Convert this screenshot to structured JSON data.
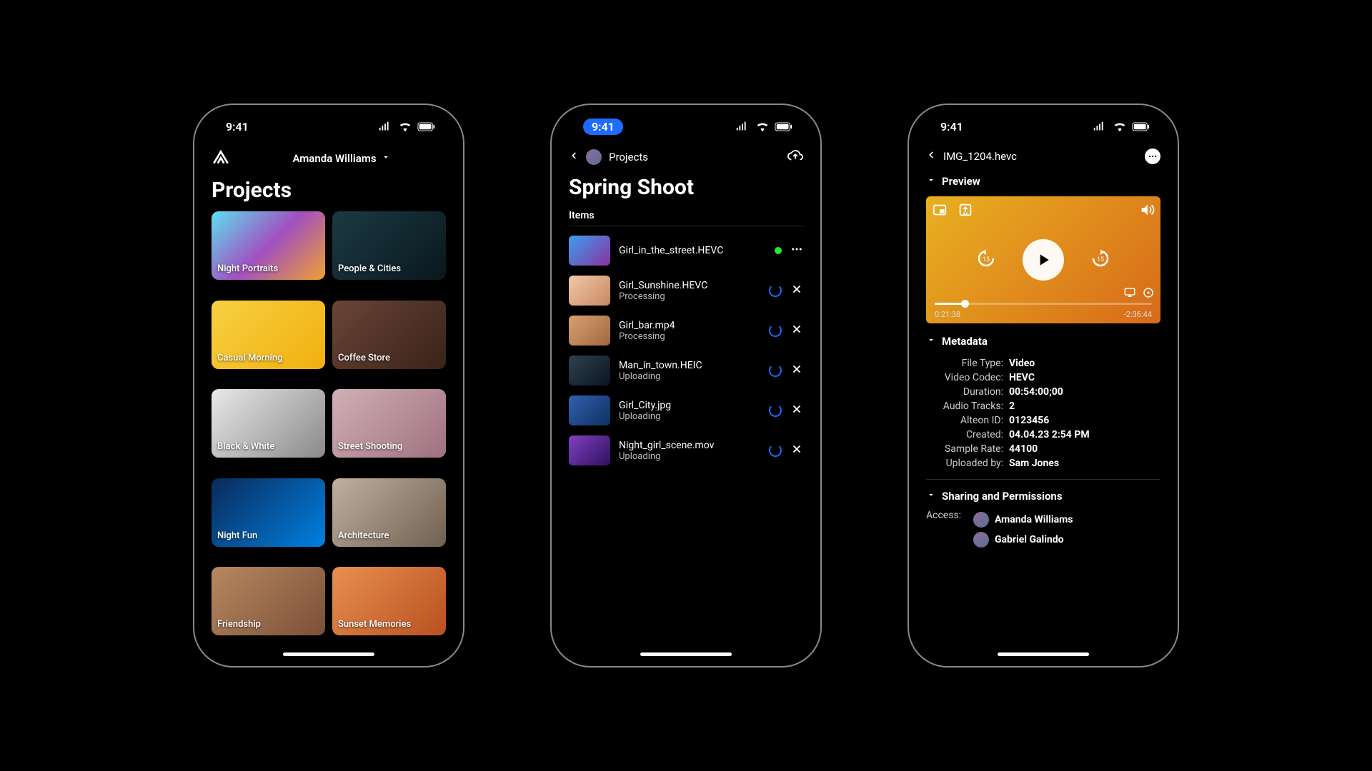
{
  "status_time": "9:41",
  "phone1": {
    "user": "Amanda Williams",
    "title": "Projects",
    "cards": [
      "Night Portraits",
      "People & Cities",
      "Casual Morning",
      "Coffee Store",
      "Black & White",
      "Street Shooting",
      "Night Fun",
      "Architecture",
      "Friendship",
      "Sunset Memories"
    ]
  },
  "phone2": {
    "breadcrumb": "Projects",
    "title": "Spring Shoot",
    "section": "Items",
    "items": [
      {
        "name": "Girl_in_the_street.HEVC",
        "status": "",
        "state": "done"
      },
      {
        "name": "Girl_Sunshine.HEVC",
        "status": "Processing",
        "state": "proc"
      },
      {
        "name": "Girl_bar.mp4",
        "status": "Processing",
        "state": "proc"
      },
      {
        "name": "Man_in_town.HEIC",
        "status": "Uploading",
        "state": "up"
      },
      {
        "name": "Girl_City.jpg",
        "status": "Uploading",
        "state": "up"
      },
      {
        "name": "Night_girl_scene.mov",
        "status": "Uploading",
        "state": "up"
      }
    ]
  },
  "phone3": {
    "filename": "IMG_1204.hevc",
    "section_preview": "Preview",
    "time_elapsed": "0:21:38",
    "time_remain": "-2:36:44",
    "section_meta": "Metadata",
    "meta": [
      {
        "k": "File Type:",
        "v": "Video"
      },
      {
        "k": "Video Codec:",
        "v": "HEVC"
      },
      {
        "k": "Duration:",
        "v": "00:54:00;00"
      },
      {
        "k": "Audio Tracks:",
        "v": "2"
      },
      {
        "k": "Alteon ID:",
        "v": "0123456"
      },
      {
        "k": "Created:",
        "v": "04.04.23 2:54 PM"
      },
      {
        "k": "Sample Rate:",
        "v": "44100"
      },
      {
        "k": "Uploaded by:",
        "v": "Sam Jones"
      }
    ],
    "section_share": "Sharing and Permissions",
    "access_label": "Access:",
    "people": [
      "Amanda Williams",
      "Gabriel Galindo"
    ]
  }
}
